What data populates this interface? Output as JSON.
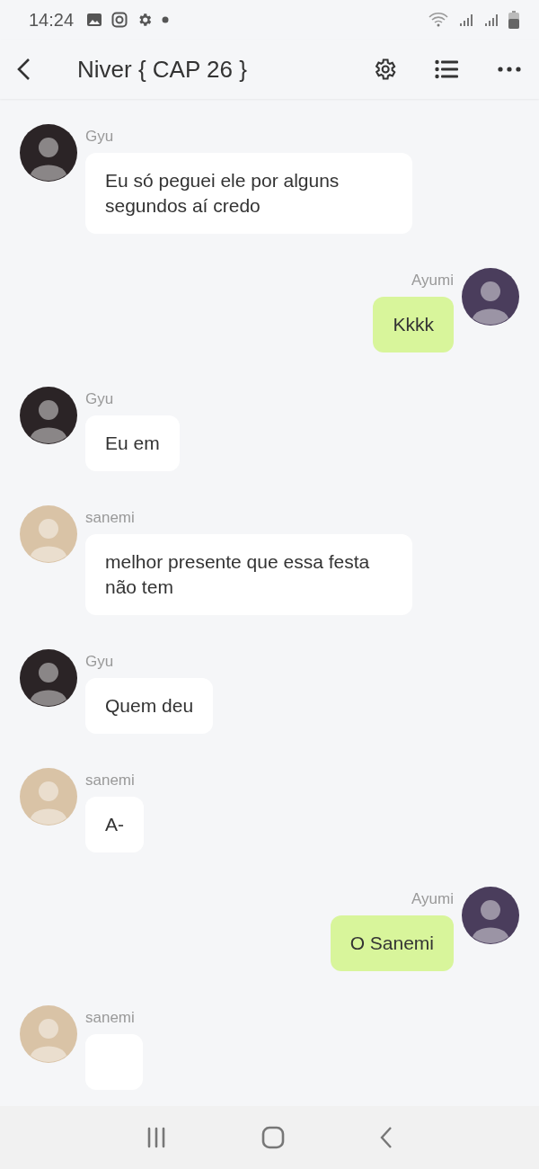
{
  "status_bar": {
    "time": "14:24"
  },
  "header": {
    "title": "Niver { CAP 26 }"
  },
  "messages": [
    {
      "kind": "in",
      "sender": "Gyu",
      "color": "#2b2426",
      "text": "Eu só peguei ele por alguns segundos aí credo"
    },
    {
      "kind": "out",
      "sender": "Ayumi",
      "color": "#4a3d5c",
      "text": "Kkkk"
    },
    {
      "kind": "in",
      "sender": "Gyu",
      "color": "#2b2426",
      "text": "Eu em"
    },
    {
      "kind": "in",
      "sender": "sanemi",
      "color": "#d9c3a6",
      "text": "melhor presente que essa festa não tem"
    },
    {
      "kind": "in",
      "sender": "Gyu",
      "color": "#2b2426",
      "text": "Quem deu"
    },
    {
      "kind": "in",
      "sender": "sanemi",
      "color": "#d9c3a6",
      "text": "A-"
    },
    {
      "kind": "out",
      "sender": "Ayumi",
      "color": "#4a3d5c",
      "text": "O Sanemi"
    },
    {
      "kind": "in",
      "sender": "sanemi",
      "color": "#d9c3a6"
    }
  ]
}
